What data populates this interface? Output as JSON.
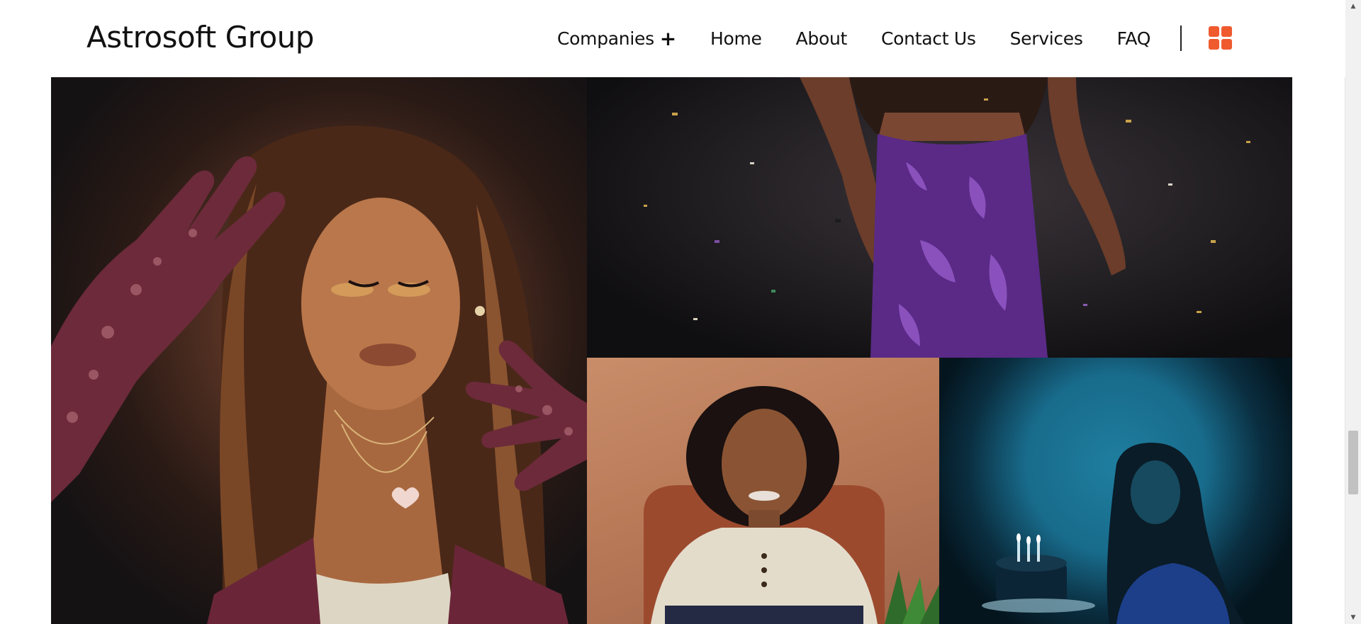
{
  "brand": {
    "name": "Astrosoft Group"
  },
  "nav": {
    "items": [
      {
        "label": "Companies",
        "has_submenu": true,
        "submenu_icon": "+"
      },
      {
        "label": "Home"
      },
      {
        "label": "About"
      },
      {
        "label": "Contact Us"
      },
      {
        "label": "Services"
      },
      {
        "label": "FAQ"
      }
    ],
    "menu_icon": "grid-icon",
    "accent_color": "#ef5a2f"
  },
  "gallery": {
    "photos": [
      {
        "subject": "woman with sequined burgundy gloves"
      },
      {
        "subject": "woman in purple dress with confetti"
      },
      {
        "subject": "woman seated in chair"
      },
      {
        "subject": "woman with birthday cake in blue spotlight"
      }
    ]
  },
  "scrollbar": {
    "position": 0.78
  }
}
